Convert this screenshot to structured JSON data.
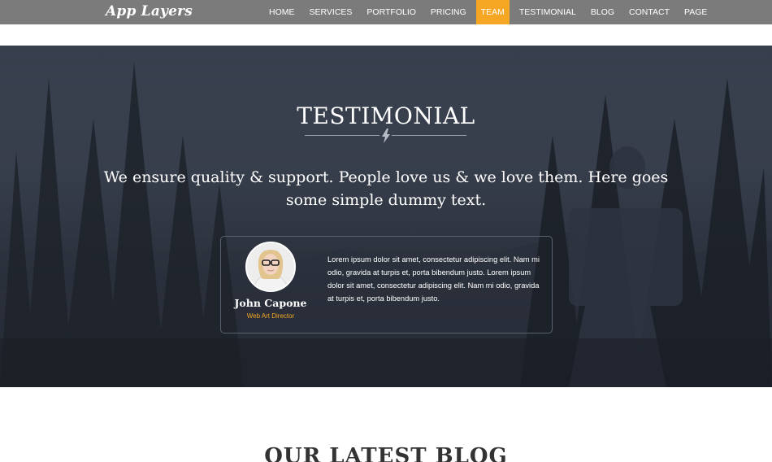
{
  "header": {
    "logo": "App Layers",
    "nav": [
      {
        "label": "HOME",
        "active": false
      },
      {
        "label": "SERVICES",
        "active": false
      },
      {
        "label": "PORTFOLIO",
        "active": false
      },
      {
        "label": "PRICING",
        "active": false
      },
      {
        "label": "TEAM",
        "active": true
      },
      {
        "label": "TESTIMONIAL",
        "active": false
      },
      {
        "label": "BLOG",
        "active": false
      },
      {
        "label": "CONTACT",
        "active": false
      },
      {
        "label": "PAGE",
        "active": false
      }
    ],
    "active_color": "#f5a623"
  },
  "testimonial": {
    "title": "TESTIMONIAL",
    "tagline": "We ensure quality & support. People love us & we love them. Here goes some simple dummy text.",
    "person": {
      "name": "John Capone",
      "role": "Web Art Director"
    },
    "quote": "Lorem ipsum dolor sit amet, consectetur adipiscing elit. Nam mi odio, gravida at turpis et, porta bibendum justo. Lorem ipsum dolor sit amet, consectetur adipiscing elit. Nam mi odio, gravida at turpis et, porta bibendum justo."
  },
  "blog": {
    "heading": "OUR LATEST BLOG"
  }
}
